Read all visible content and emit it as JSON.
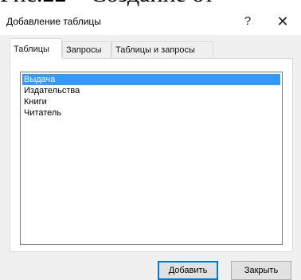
{
  "background_caption": "Рис.22 – Создание от",
  "dialog": {
    "title": "Добавление таблицы",
    "help_glyph": "?",
    "close_glyph": "✕"
  },
  "tabs": [
    {
      "label": "Таблицы",
      "active": true
    },
    {
      "label": "Запросы",
      "active": false
    },
    {
      "label": "Таблицы и запросы",
      "active": false
    }
  ],
  "list": {
    "items": [
      {
        "label": "Выдача",
        "selected": true
      },
      {
        "label": "Издательства",
        "selected": false
      },
      {
        "label": "Книги",
        "selected": false
      },
      {
        "label": "Читатель",
        "selected": false
      }
    ]
  },
  "buttons": {
    "add_label": "Добавить",
    "close_label": "Закрыть"
  },
  "colors": {
    "selection": "#3399ff",
    "default_button_border": "#0078d7",
    "dialog_background": "#f0f0f0"
  }
}
